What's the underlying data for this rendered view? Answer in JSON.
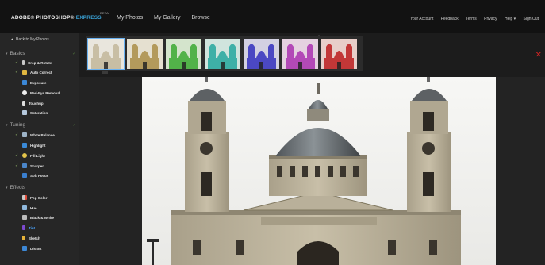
{
  "app": {
    "logo_main": "ADOBE® PHOTOSHOP® ",
    "logo_express": "EXPRESS",
    "logo_beta": "BETA"
  },
  "mainnav": [
    "My Photos",
    "My Gallery",
    "Browse"
  ],
  "rightnav": [
    "Your Account",
    "Feedback",
    "Terms",
    "Privacy",
    "Help ▾",
    "Sign Out"
  ],
  "sidebar": {
    "back_label": "Back to My Photos",
    "sections": [
      {
        "label": "Basics",
        "items": [
          "Crop & Rotate",
          "Auto Correct",
          "Exposure",
          "Red-Eye Removal",
          "Touchup",
          "Saturation"
        ]
      },
      {
        "label": "Tuning",
        "items": [
          "White Balance",
          "Highlight",
          "Fill Light",
          "Sharpen",
          "Soft Focus"
        ]
      },
      {
        "label": "Effects",
        "items": [
          "Pop Color",
          "Hue",
          "Black & White",
          "Tint",
          "Sketch",
          "Distort"
        ]
      }
    ],
    "selected_item": "Tint"
  },
  "filmstrip": {
    "tints": [
      "#c9bfa4",
      "#b49a5c",
      "#52b34a",
      "#3fb0a8",
      "#4b49c4",
      "#b44ab8",
      "#c23838"
    ]
  },
  "colors": {
    "accent": "#3aa3d8",
    "close": "#d62424",
    "selected": "#49a4ff"
  }
}
